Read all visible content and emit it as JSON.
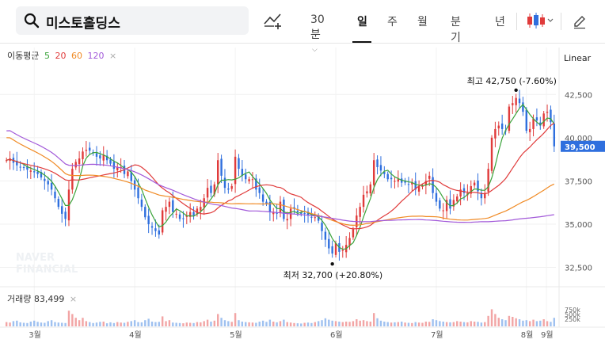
{
  "search": {
    "value": "미스토홀딩스"
  },
  "tabs": [
    {
      "label": "30분",
      "has_caret": true
    },
    {
      "label": "일",
      "active": true
    },
    {
      "label": "주"
    },
    {
      "label": "월"
    },
    {
      "label": "분기"
    },
    {
      "label": "년"
    }
  ],
  "toolbar": {
    "chart_type_icon": "candlestick-icon",
    "draw_icon": "pencil-icon",
    "indicator_icon": "trend-add-icon"
  },
  "legend": {
    "title": "이동평균",
    "items": [
      {
        "label": "5",
        "color": "#3aa33a"
      },
      {
        "label": "20",
        "color": "#e03b3b"
      },
      {
        "label": "60",
        "color": "#f08a24"
      },
      {
        "label": "120",
        "color": "#a259d9"
      }
    ],
    "close": "×"
  },
  "scale_mode": "Linear",
  "volume": {
    "label": "거래량 83,499",
    "close": "×",
    "ticks": [
      "750k",
      "500k",
      "250k"
    ]
  },
  "watermark": [
    "NAVER",
    "FINANCIAL"
  ],
  "chart_data": {
    "type": "candlestick",
    "y_ticks": [
      42500,
      40000,
      37500,
      35000,
      32500
    ],
    "y_tick_labels": [
      "42,500",
      "40,000",
      "37,500",
      "35,000",
      "32,500"
    ],
    "ylim": [
      31700,
      44300
    ],
    "x_tick_labels": [
      "3월",
      "4월",
      "5월",
      "6월",
      "7월",
      "8월",
      "9월"
    ],
    "current_price": {
      "value": 39500,
      "label": "39,500",
      "color": "#2f6fde"
    },
    "annotations": [
      {
        "text": "최고 42,750 (-7.60%)",
        "value": 42750
      },
      {
        "text": "최저 32,700 (+20.80%)",
        "value": 32700
      }
    ],
    "up_color": "#e03b3b",
    "down_color": "#2f6fde",
    "ma_colors": {
      "ma5": "#3aa33a",
      "ma20": "#e03b3b",
      "ma60": "#f08a24",
      "ma120": "#a259d9"
    },
    "close_series": [
      38700,
      38800,
      38550,
      38400,
      38300,
      38250,
      38150,
      38100,
      38000,
      37900,
      37700,
      37500,
      37300,
      37000,
      36500,
      36000,
      35600,
      35300,
      37000,
      38200,
      38600,
      38800,
      39200,
      39300,
      39250,
      39100,
      38900,
      38800,
      39000,
      38700,
      38500,
      38200,
      38300,
      38300,
      37900,
      38050,
      37500,
      37000,
      36500,
      36000,
      35400,
      35000,
      34800,
      34600,
      34400,
      35800,
      36000,
      36300,
      35700,
      35600,
      35300,
      35300,
      35500,
      35700,
      35500,
      35900,
      36000,
      36500,
      37100,
      36800,
      37300,
      38700,
      37800,
      37100,
      37000,
      37200,
      38900,
      38200,
      37800,
      37600,
      37600,
      37600,
      37000,
      36800,
      36300,
      36200,
      35700,
      35700,
      35600,
      36300,
      35300,
      35300,
      35900,
      35900,
      35700,
      35600,
      35600,
      35500,
      35400,
      35400,
      35200,
      34600,
      34100,
      33600,
      33300,
      33900,
      33400,
      33500,
      33800,
      34200,
      34700,
      35500,
      36000,
      36700,
      36900,
      37300,
      38700,
      38300,
      38100,
      37900,
      37600,
      37600,
      37500,
      37600,
      37400,
      37400,
      37300,
      37400,
      37000,
      37200,
      37200,
      37500,
      37800,
      36800,
      36300,
      35900,
      35800,
      36400,
      35900,
      36400,
      36600,
      37000,
      36800,
      36800,
      37200,
      37400,
      36900,
      36500,
      36800,
      38200,
      40000,
      40500,
      40700,
      40500,
      40400,
      41800,
      42000,
      42300,
      42000,
      41500,
      40400,
      40500,
      41100,
      41000,
      40700,
      41400,
      41500,
      40900,
      39500
    ],
    "volume_series": [
      90,
      80,
      110,
      120,
      85,
      75,
      70,
      100,
      120,
      95,
      80,
      75,
      110,
      130,
      90,
      80,
      75,
      70,
      330,
      260,
      180,
      130,
      180,
      110,
      90,
      70,
      80,
      95,
      100,
      65,
      85,
      70,
      90,
      80,
      75,
      95,
      110,
      130,
      90,
      85,
      130,
      160,
      100,
      90,
      95,
      210,
      110,
      130,
      80,
      75,
      70,
      65,
      80,
      75,
      70,
      90,
      85,
      110,
      140,
      100,
      120,
      260,
      180,
      130,
      110,
      95,
      280,
      130,
      100,
      90,
      85,
      80,
      75,
      100,
      120,
      95,
      140,
      100,
      85,
      110,
      140,
      90,
      80,
      70,
      65,
      60,
      75,
      80,
      70,
      90,
      110,
      130,
      170,
      140,
      120,
      110,
      100,
      90,
      100,
      95,
      110,
      150,
      120,
      130,
      110,
      100,
      280,
      170,
      120,
      100,
      90,
      80,
      85,
      90,
      100,
      80,
      75,
      70,
      90,
      80,
      75,
      100,
      95,
      150,
      130,
      110,
      100,
      90,
      85,
      90,
      110,
      100,
      90,
      85,
      110,
      100,
      95,
      80,
      90,
      220,
      360,
      260,
      180,
      150,
      130,
      220,
      200,
      170,
      150,
      120,
      130,
      110,
      140,
      110,
      120,
      150,
      110,
      95,
      180
    ]
  }
}
